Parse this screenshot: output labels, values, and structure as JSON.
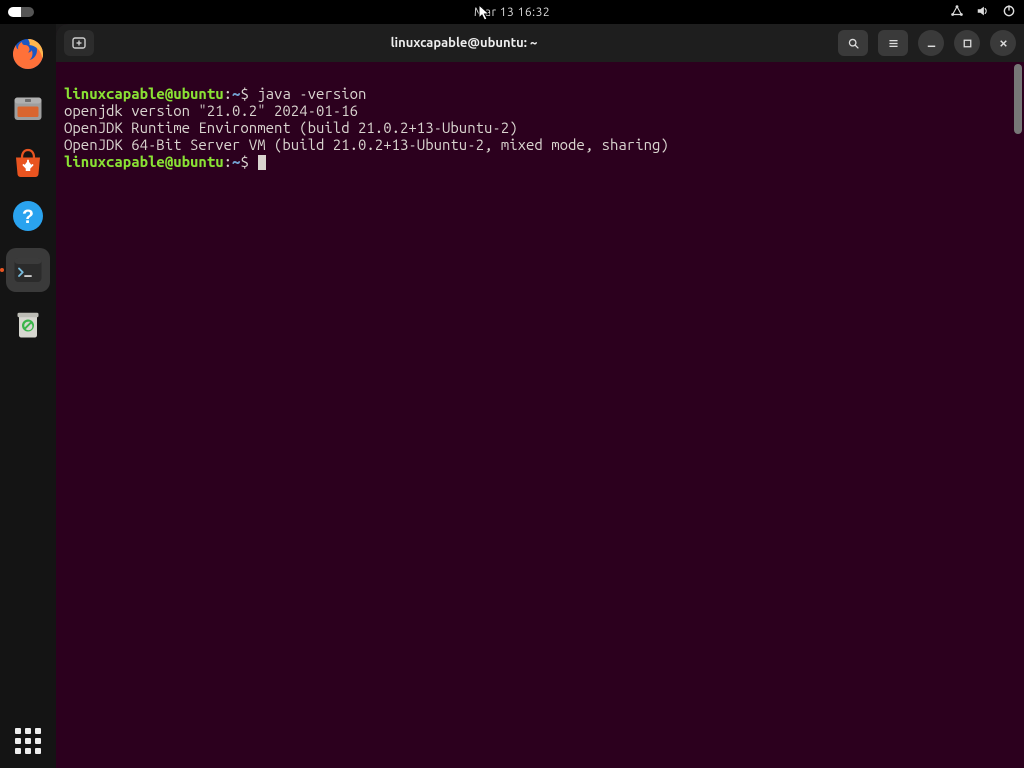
{
  "topbar": {
    "clock": "Mar 13  16:32"
  },
  "dock": {
    "apps": [
      {
        "name": "firefox"
      },
      {
        "name": "files"
      },
      {
        "name": "software"
      },
      {
        "name": "help"
      },
      {
        "name": "terminal"
      },
      {
        "name": "trash"
      }
    ]
  },
  "window": {
    "title": "linuxcapable@ubuntu: ~"
  },
  "terminal": {
    "prompt": {
      "user": "linuxcapable",
      "at": "@",
      "host": "ubuntu",
      "colon": ":",
      "path": "~",
      "dollar": "$"
    },
    "command": "java -version",
    "output": [
      "openjdk version \"21.0.2\" 2024-01-16",
      "OpenJDK Runtime Environment (build 21.0.2+13-Ubuntu-2)",
      "OpenJDK 64-Bit Server VM (build 21.0.2+13-Ubuntu-2, mixed mode, sharing)"
    ]
  }
}
